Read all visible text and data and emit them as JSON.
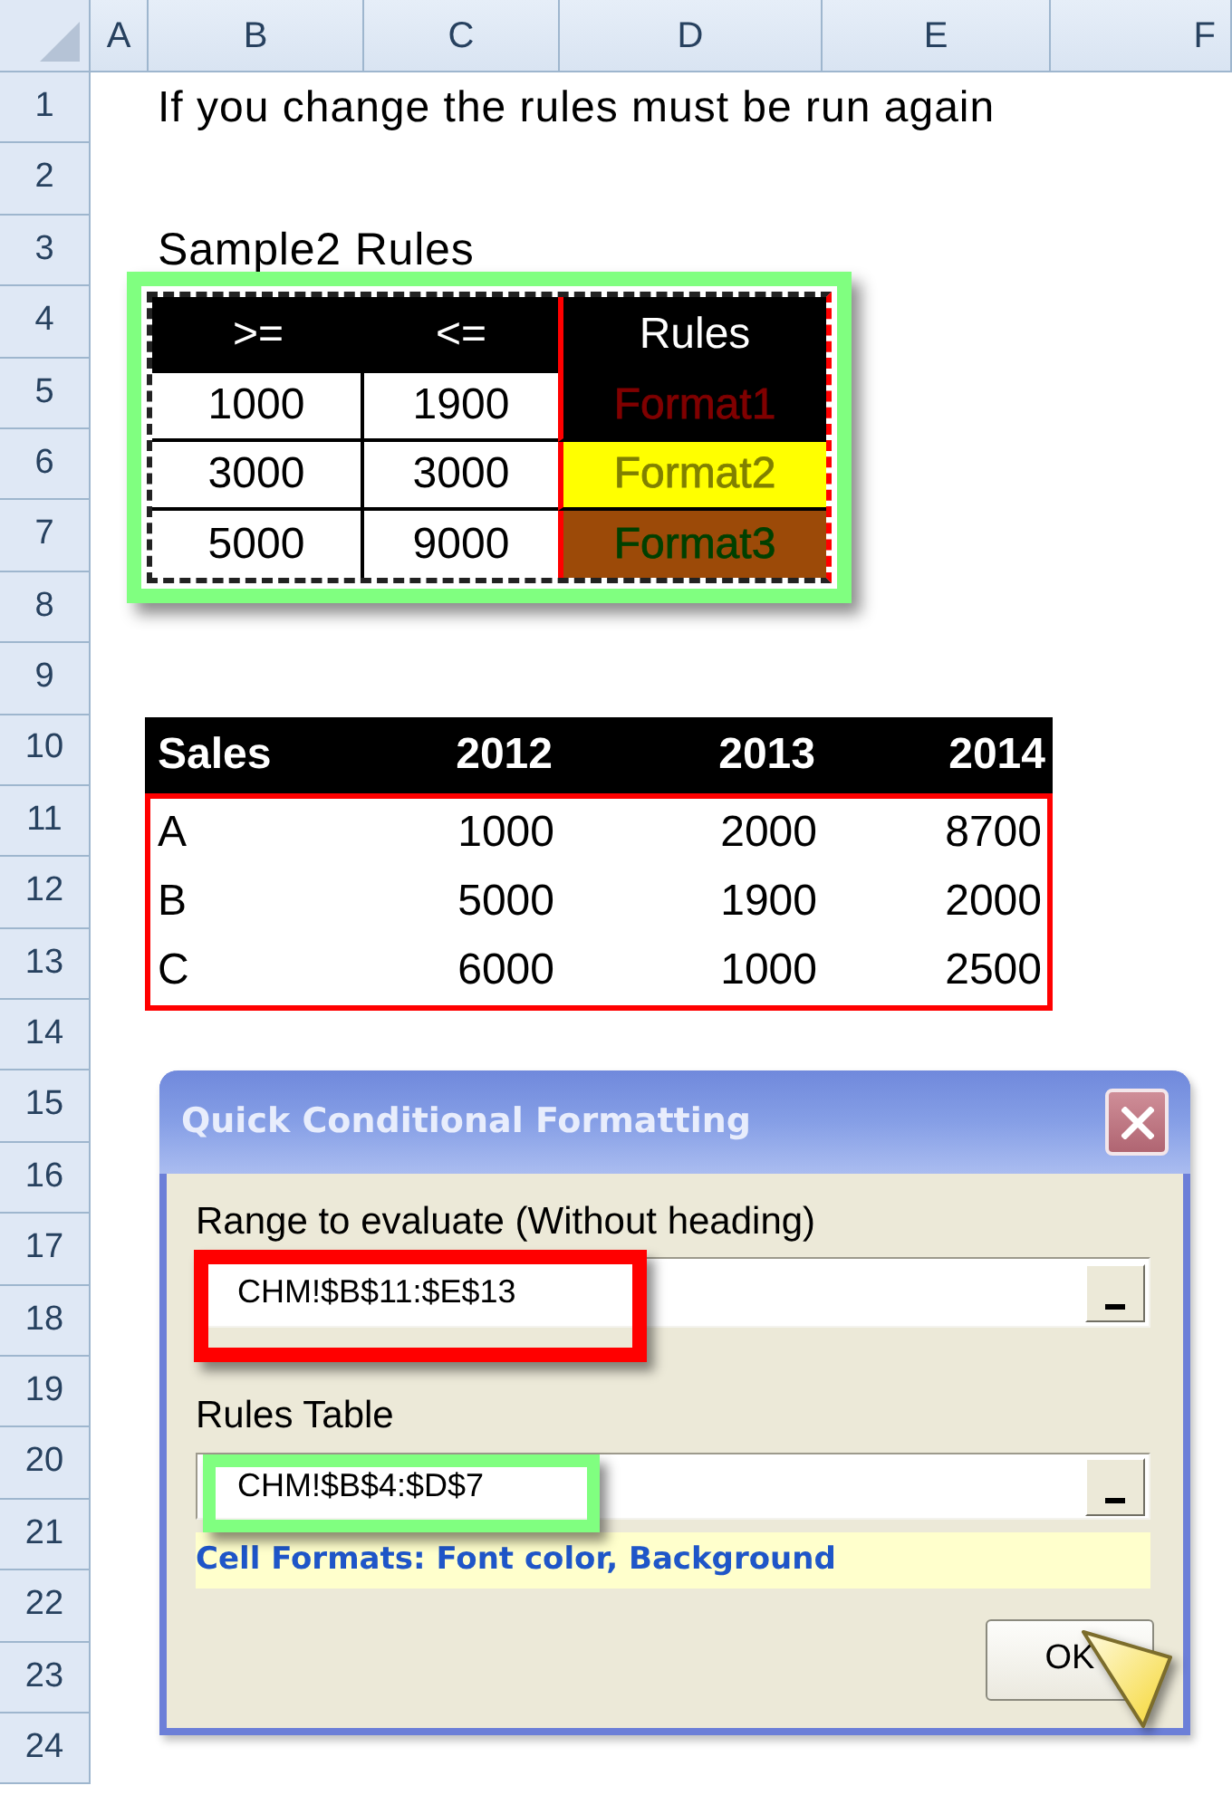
{
  "spreadsheet": {
    "column_headers": [
      "A",
      "B",
      "C",
      "D",
      "E",
      "F"
    ],
    "row_headers": [
      "1",
      "2",
      "3",
      "4",
      "5",
      "6",
      "7",
      "8",
      "9",
      "10",
      "11",
      "12",
      "13",
      "14",
      "15",
      "16",
      "17",
      "18",
      "19",
      "20",
      "21",
      "22",
      "23",
      "24"
    ],
    "note": "If you change the rules must be run again",
    "rules_title": "Sample2 Rules",
    "rules_table": {
      "columns": [
        ">=",
        "<=",
        "Rules"
      ],
      "rows": [
        {
          "cells": [
            "1000",
            "1900"
          ],
          "format": {
            "text": "Format1",
            "color": "#800000"
          },
          "fill": {
            "color": "#000000"
          }
        },
        {
          "cells": [
            "3000",
            "3000"
          ],
          "format": {
            "text": "Format2",
            "color": "#808000"
          },
          "fill": {
            "color": "#ffff00"
          }
        },
        {
          "cells": [
            "5000",
            "9000"
          ],
          "format": {
            "text": "Format3",
            "color": "#004000"
          },
          "fill": {
            "color": "#9c4a08"
          }
        }
      ]
    },
    "sales_table": {
      "columns": [
        "Sales",
        "2012",
        "2013",
        "2014"
      ],
      "rows": [
        [
          "A",
          "1000",
          "2000",
          "8700"
        ],
        [
          "B",
          "5000",
          "1900",
          "2000"
        ],
        [
          "C",
          "6000",
          "1000",
          "2500"
        ]
      ]
    }
  },
  "dialog": {
    "title": "Quick Conditional Formatting",
    "fields": [
      {
        "label": "Range to evaluate (Without heading)",
        "value": "CHM!$B$11:$E$13",
        "color": "#ff0000"
      },
      {
        "label": "Rules Table",
        "value": "CHM!$B$4:$D$7",
        "color": "#80ff80"
      }
    ],
    "info": "Cell Formats: Font color, Background",
    "buttons": [
      "OK"
    ]
  }
}
